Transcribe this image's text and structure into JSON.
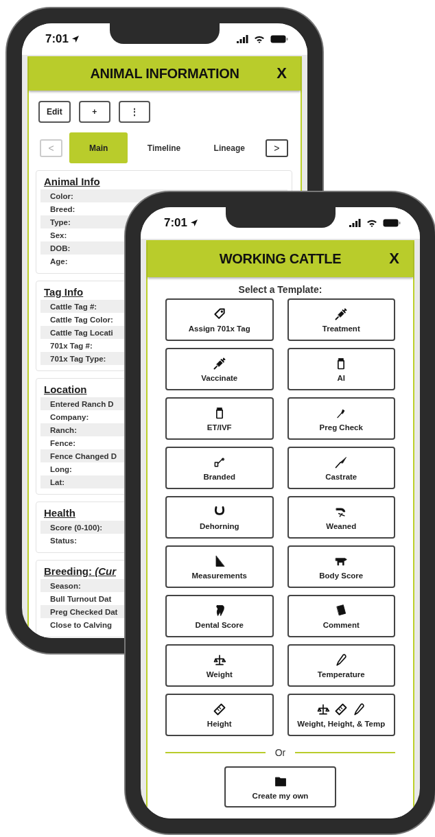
{
  "animal_information": {
    "status_bar": {
      "time": "7:01"
    },
    "title": "ANIMAL INFORMATION",
    "close": "X",
    "actions": [
      "Edit",
      "+",
      "⋮"
    ],
    "prev": {
      "label": "<",
      "disabled": true
    },
    "tabs": [
      {
        "label": "Main",
        "selected": true
      },
      {
        "label": "Timeline",
        "selected": false
      },
      {
        "label": "Lineage",
        "selected": false
      }
    ],
    "next": {
      "label": ">",
      "disabled": false
    },
    "sections": [
      {
        "title": "Animal Info",
        "fields": [
          "Color:",
          "Breed:",
          "Type:",
          "Sex:",
          "DOB:",
          "Age:"
        ]
      },
      {
        "title": "Tag Info",
        "fields": [
          "Cattle Tag #:",
          "Cattle Tag Color:",
          "Cattle Tag Locati",
          "701x Tag #:",
          "701x Tag Type:"
        ]
      },
      {
        "title": "Location",
        "fields": [
          "Entered Ranch D",
          "Company:",
          "Ranch:",
          "Fence:",
          "Fence Changed D",
          "Long:",
          "Lat:"
        ]
      },
      {
        "title": "Health",
        "fields": [
          "Score (0-100):",
          "Status:"
        ]
      },
      {
        "title": "Breeding: *(Cur*",
        "fields": [
          "Season:",
          "Bull Turnout Dat",
          "Preg Checked Dat",
          "Close to Calving"
        ]
      }
    ]
  },
  "working_cattle": {
    "status_bar": {
      "time": "7:01"
    },
    "title": "WORKING CATTLE",
    "close": "X",
    "prompt": "Select a Template:",
    "templates": [
      "Assign 701x Tag",
      "Treatment",
      "Vaccinate",
      "AI",
      "ET/IVF",
      "Preg Check",
      "Branded",
      "Castrate",
      "Dehorning",
      "Weaned",
      "Measurements",
      "Body Score",
      "Dental Score",
      "Comment",
      "Weight",
      "Temperature",
      "Height",
      "Weight, Height, & Temp"
    ],
    "divider": "Or",
    "create": "Create my own"
  }
}
